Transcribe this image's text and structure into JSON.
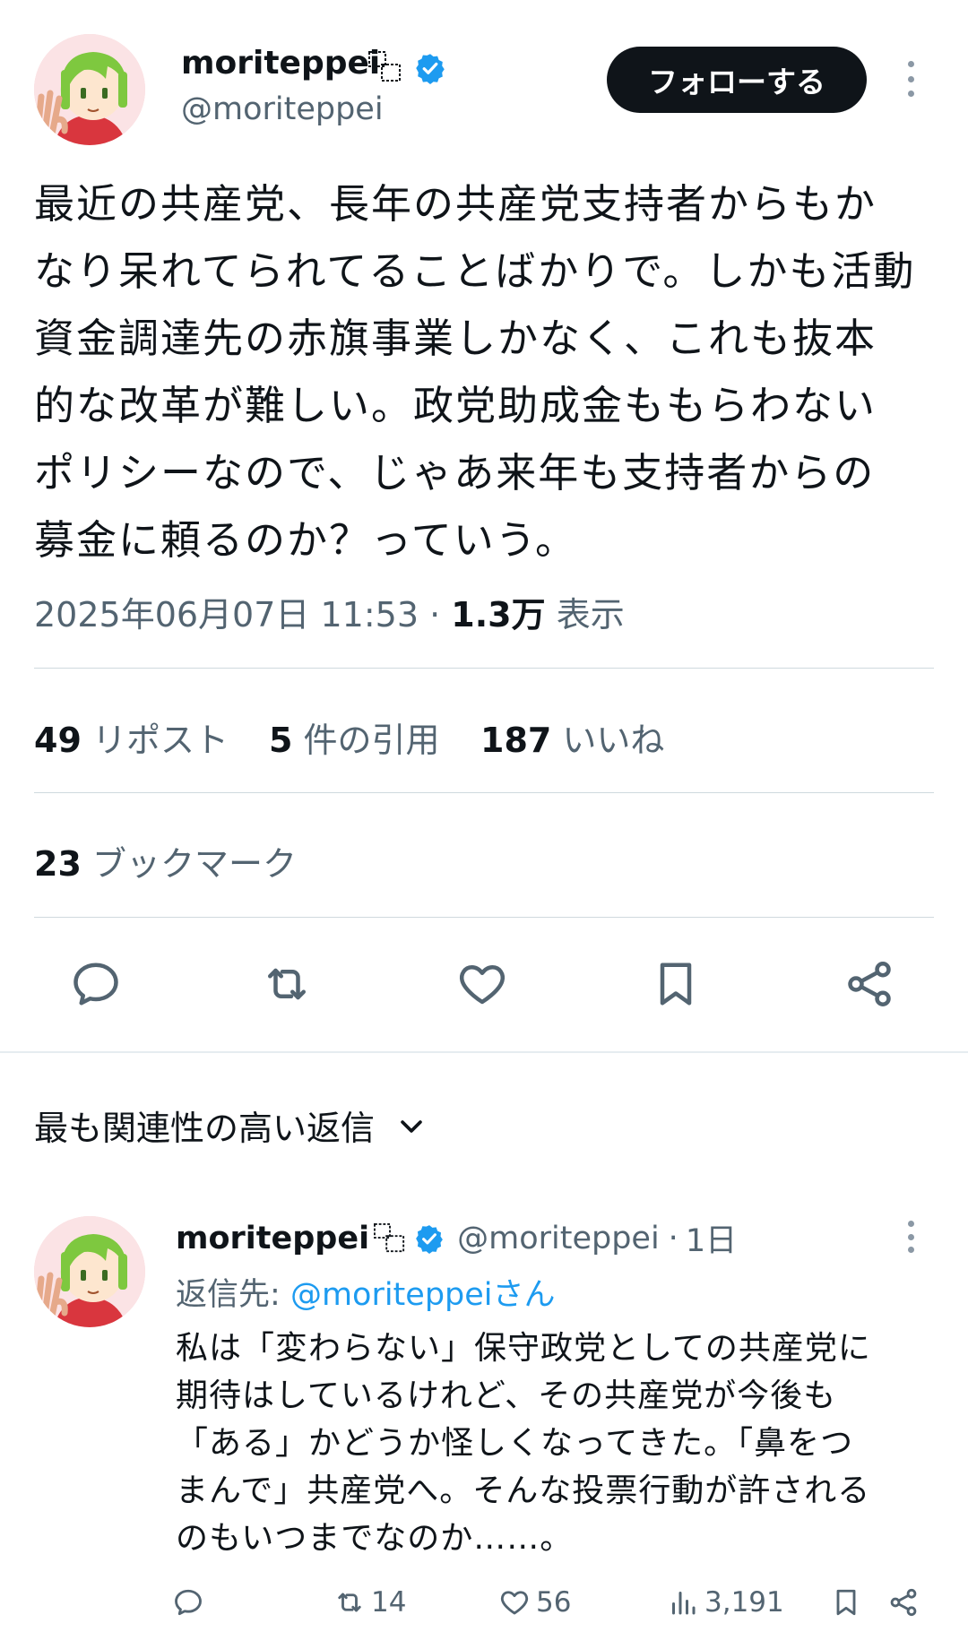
{
  "tweet": {
    "author": {
      "display_name": "moriteppei",
      "handle": "@moriteppei",
      "verified": true,
      "avatar": "anime-avatar-green-hair"
    },
    "follow_label": "フォローする",
    "text_lines": [
      "最近の共産党、長年の共産党支持者からもか",
      "なり呆れてられてることばかりで。しかも活動",
      "資金調達先の赤旗事業しかなく、これも抜本",
      "的な改革が難しい。政党助成金ももらわない",
      "ポリシーなので、じゃあ来年も支持者からの",
      "募金に頼るのか？っていう。"
    ],
    "timestamp": "2025年06月07日 11:53",
    "separator": "·",
    "views_value": "1.3万",
    "views_label": "表示"
  },
  "stats": {
    "reposts": {
      "count": "49",
      "label": "リポスト"
    },
    "quotes": {
      "count": "5",
      "label": "件の引用"
    },
    "likes": {
      "count": "187",
      "label": "いいね"
    },
    "bookmarks": {
      "count": "23",
      "label": "ブックマーク"
    }
  },
  "actions": [
    "reply-icon",
    "repost-icon",
    "like-icon",
    "bookmark-icon",
    "share-icon"
  ],
  "replies_section": {
    "sort_label": "最も関連性の高い返信"
  },
  "reply": {
    "display_name": "moriteppei",
    "handle": "@moriteppei",
    "separator": "·",
    "time": "1日",
    "replying_to_label": "返信先:",
    "replying_to_handle": "@moriteppeiさん",
    "text_lines": [
      "私は「変わらない」保守政党としての共産党に",
      "期待はしているけれど、その共産党が今後も",
      "「ある」かどうか怪しくなってきた。「鼻をつ",
      "まんで」共産党へ。そんな投票行動が許される",
      "のもいつまでなのか……。"
    ],
    "metrics": {
      "reposts": "14",
      "likes": "56",
      "views": "3,191"
    }
  },
  "colors": {
    "text": "#0f1419",
    "secondary": "#536471",
    "accent": "#1d9bf0",
    "divider": "#cfd9de"
  }
}
